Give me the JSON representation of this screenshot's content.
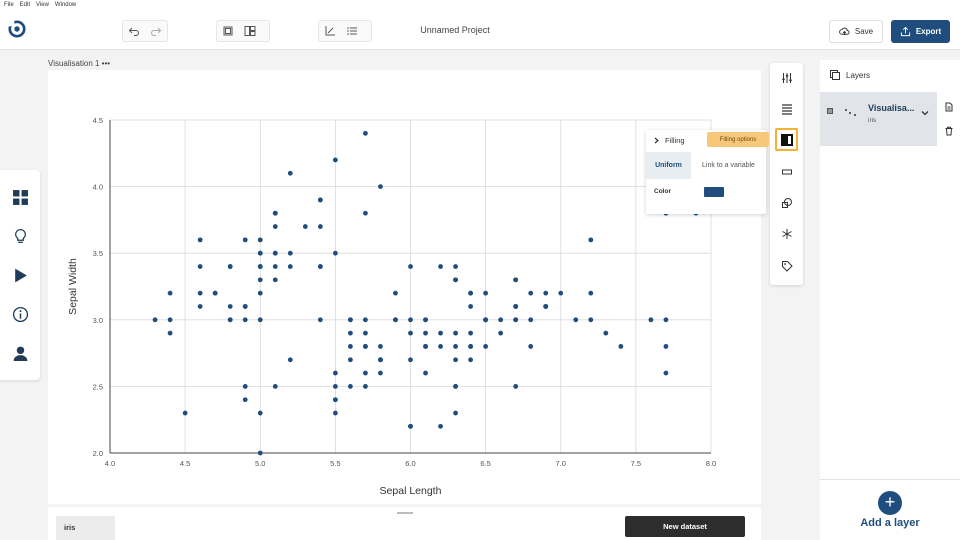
{
  "menu": [
    "File",
    "Edit",
    "View",
    "Window"
  ],
  "toolbar": {
    "project_title": "Unnamed Project",
    "save_label": "Save",
    "export_label": "Export"
  },
  "visualisation": {
    "label": "Visualisation 1 •••"
  },
  "tools": {
    "filling_label": "Filling",
    "tooltip": "Filling options",
    "uniform_label": "Uniform",
    "link_label": "Link to a variable",
    "color_label": "Color",
    "color_value": "#1f4e7e"
  },
  "layers": {
    "header": "Layers",
    "items": [
      {
        "name": "Visualisa...",
        "dataset": "iris"
      }
    ],
    "add_label": "Add a layer"
  },
  "datasets": {
    "tab": "iris",
    "new_label": "New dataset"
  },
  "colors": {
    "accent": "#1f4e7e",
    "highlight": "#f2b233",
    "point": "#1f4e7e"
  },
  "chart_data": {
    "type": "scatter",
    "xlabel": "Sepal Length",
    "ylabel": "Sepal Width",
    "xlim": [
      4.0,
      8.0
    ],
    "ylim": [
      2.0,
      4.5
    ],
    "xticks": [
      "4.0",
      "4.5",
      "5.0",
      "5.5",
      "6.0",
      "6.5",
      "7.0",
      "7.5",
      "8.0"
    ],
    "yticks": [
      "2.0",
      "2.5",
      "3.0",
      "3.5",
      "4.0",
      "4.5"
    ],
    "grid": true,
    "points": [
      [
        5.1,
        3.5
      ],
      [
        4.9,
        3.0
      ],
      [
        4.7,
        3.2
      ],
      [
        4.6,
        3.1
      ],
      [
        5.0,
        3.6
      ],
      [
        5.4,
        3.9
      ],
      [
        4.6,
        3.4
      ],
      [
        5.0,
        3.4
      ],
      [
        4.4,
        2.9
      ],
      [
        4.9,
        3.1
      ],
      [
        5.4,
        3.7
      ],
      [
        4.8,
        3.4
      ],
      [
        4.8,
        3.0
      ],
      [
        4.3,
        3.0
      ],
      [
        5.8,
        4.0
      ],
      [
        5.7,
        4.4
      ],
      [
        5.4,
        3.9
      ],
      [
        5.1,
        3.5
      ],
      [
        5.7,
        3.8
      ],
      [
        5.1,
        3.8
      ],
      [
        5.4,
        3.4
      ],
      [
        5.1,
        3.7
      ],
      [
        4.6,
        3.6
      ],
      [
        5.1,
        3.3
      ],
      [
        4.8,
        3.4
      ],
      [
        5.0,
        3.0
      ],
      [
        5.0,
        3.4
      ],
      [
        5.2,
        3.5
      ],
      [
        5.2,
        3.4
      ],
      [
        4.7,
        3.2
      ],
      [
        4.8,
        3.1
      ],
      [
        5.4,
        3.4
      ],
      [
        5.2,
        4.1
      ],
      [
        5.5,
        4.2
      ],
      [
        4.9,
        3.1
      ],
      [
        5.0,
        3.2
      ],
      [
        5.5,
        3.5
      ],
      [
        4.9,
        3.6
      ],
      [
        4.4,
        3.0
      ],
      [
        5.1,
        3.4
      ],
      [
        5.0,
        3.5
      ],
      [
        4.5,
        2.3
      ],
      [
        4.4,
        3.2
      ],
      [
        5.0,
        3.5
      ],
      [
        5.1,
        3.8
      ],
      [
        4.8,
        3.0
      ],
      [
        5.1,
        3.8
      ],
      [
        4.6,
        3.2
      ],
      [
        5.3,
        3.7
      ],
      [
        5.0,
        3.3
      ],
      [
        7.0,
        3.2
      ],
      [
        6.4,
        3.2
      ],
      [
        6.9,
        3.1
      ],
      [
        5.5,
        2.3
      ],
      [
        6.5,
        2.8
      ],
      [
        5.7,
        2.8
      ],
      [
        6.3,
        3.3
      ],
      [
        4.9,
        2.4
      ],
      [
        6.6,
        2.9
      ],
      [
        5.2,
        2.7
      ],
      [
        5.0,
        2.0
      ],
      [
        5.9,
        3.0
      ],
      [
        6.0,
        2.2
      ],
      [
        6.1,
        2.9
      ],
      [
        5.6,
        2.9
      ],
      [
        6.7,
        3.1
      ],
      [
        5.6,
        3.0
      ],
      [
        5.8,
        2.7
      ],
      [
        6.2,
        2.2
      ],
      [
        5.6,
        2.5
      ],
      [
        5.9,
        3.2
      ],
      [
        6.1,
        2.8
      ],
      [
        6.3,
        2.5
      ],
      [
        6.1,
        2.8
      ],
      [
        6.4,
        2.9
      ],
      [
        6.6,
        3.0
      ],
      [
        6.8,
        2.8
      ],
      [
        6.7,
        3.0
      ],
      [
        6.0,
        2.9
      ],
      [
        5.7,
        2.6
      ],
      [
        5.5,
        2.4
      ],
      [
        5.5,
        2.4
      ],
      [
        5.8,
        2.7
      ],
      [
        6.0,
        2.7
      ],
      [
        5.4,
        3.0
      ],
      [
        6.0,
        3.4
      ],
      [
        6.7,
        3.1
      ],
      [
        6.3,
        2.3
      ],
      [
        5.6,
        3.0
      ],
      [
        5.5,
        2.5
      ],
      [
        5.5,
        2.6
      ],
      [
        6.1,
        3.0
      ],
      [
        5.8,
        2.6
      ],
      [
        5.0,
        2.3
      ],
      [
        5.6,
        2.7
      ],
      [
        5.7,
        3.0
      ],
      [
        5.7,
        2.9
      ],
      [
        6.2,
        2.9
      ],
      [
        5.1,
        2.5
      ],
      [
        5.7,
        2.8
      ],
      [
        6.3,
        3.3
      ],
      [
        5.8,
        2.7
      ],
      [
        7.1,
        3.0
      ],
      [
        6.3,
        2.9
      ],
      [
        6.5,
        3.0
      ],
      [
        7.6,
        3.0
      ],
      [
        4.9,
        2.5
      ],
      [
        7.3,
        2.9
      ],
      [
        6.7,
        2.5
      ],
      [
        7.2,
        3.6
      ],
      [
        6.5,
        3.2
      ],
      [
        6.4,
        2.7
      ],
      [
        6.8,
        3.0
      ],
      [
        5.7,
        2.5
      ],
      [
        5.8,
        2.8
      ],
      [
        6.4,
        3.2
      ],
      [
        6.5,
        3.0
      ],
      [
        7.7,
        3.8
      ],
      [
        7.7,
        2.6
      ],
      [
        6.0,
        2.2
      ],
      [
        6.9,
        3.2
      ],
      [
        5.6,
        2.8
      ],
      [
        7.7,
        2.8
      ],
      [
        6.3,
        2.7
      ],
      [
        6.7,
        3.3
      ],
      [
        7.2,
        3.2
      ],
      [
        6.2,
        2.8
      ],
      [
        6.1,
        3.0
      ],
      [
        6.4,
        2.8
      ],
      [
        7.2,
        3.0
      ],
      [
        7.4,
        2.8
      ],
      [
        7.9,
        3.8
      ],
      [
        6.4,
        2.8
      ],
      [
        6.3,
        2.8
      ],
      [
        6.1,
        2.6
      ],
      [
        7.7,
        3.0
      ],
      [
        6.3,
        3.4
      ],
      [
        6.4,
        3.1
      ],
      [
        6.0,
        3.0
      ],
      [
        6.9,
        3.1
      ],
      [
        6.7,
        3.1
      ],
      [
        6.9,
        3.1
      ],
      [
        5.8,
        2.7
      ],
      [
        6.8,
        3.2
      ],
      [
        6.7,
        3.3
      ],
      [
        6.7,
        3.0
      ],
      [
        6.3,
        2.5
      ],
      [
        6.5,
        3.0
      ],
      [
        6.2,
        3.4
      ],
      [
        5.9,
        3.0
      ]
    ]
  }
}
